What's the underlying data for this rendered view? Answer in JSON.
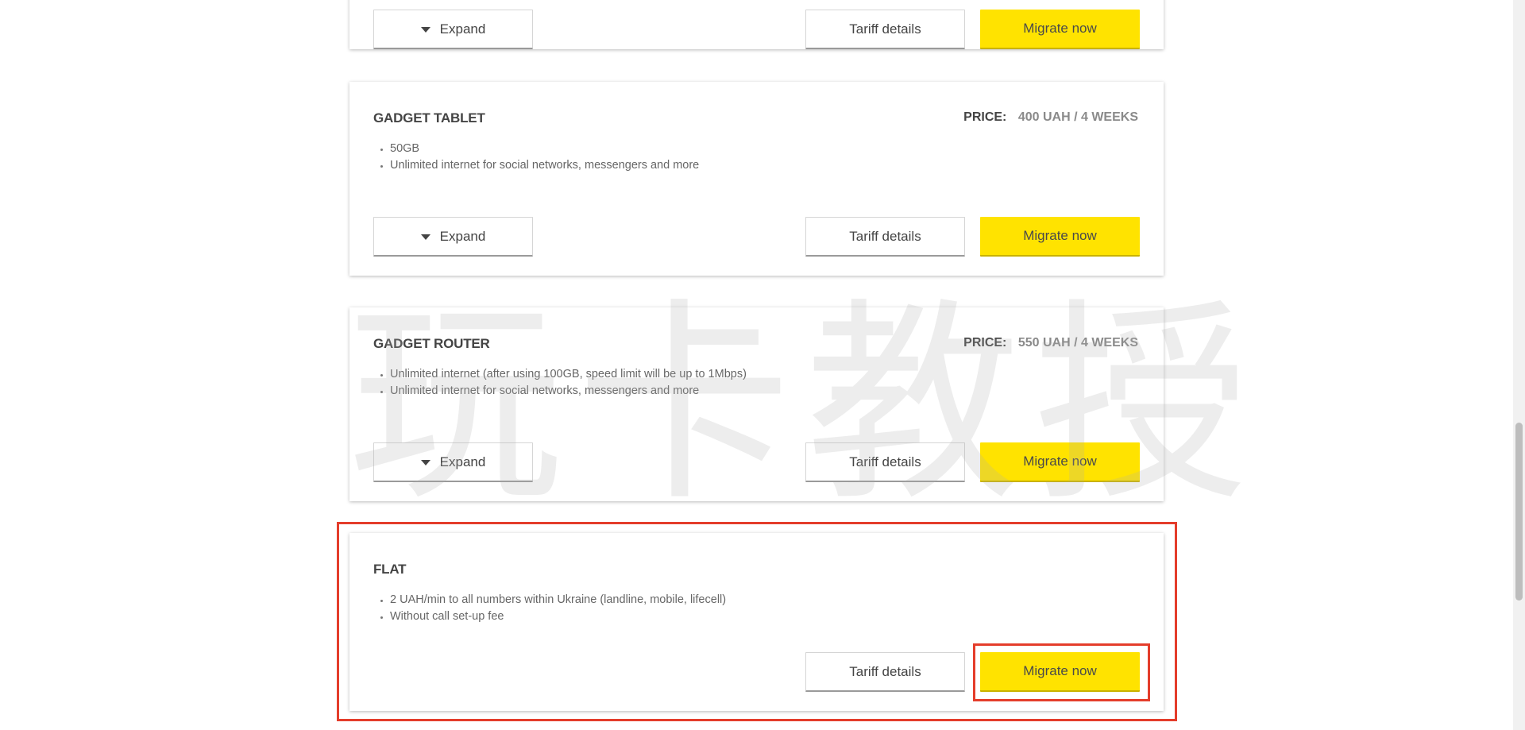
{
  "buttons": {
    "expand_label": "Expand",
    "details_label": "Tariff details",
    "migrate_label": "Migrate now"
  },
  "price_label": "PRICE:",
  "tariffs": [
    {
      "title": "",
      "price": "",
      "features": []
    },
    {
      "title": "GADGET TABLET",
      "price": "400 UAH / 4 WEEKS",
      "features": [
        "50GB",
        "Unlimited internet for social networks, messengers and more"
      ]
    },
    {
      "title": "GADGET ROUTER",
      "price": "550 UAH / 4 WEEKS",
      "features": [
        "Unlimited internet (after using 100GB, speed limit will be up to 1Mbps)",
        "Unlimited internet for social networks, messengers and more"
      ]
    },
    {
      "title": "FLAT",
      "price": "",
      "features": [
        "2 UAH/min to all numbers within Ukraine (landline, mobile, lifecell)",
        "Without call set-up fee"
      ]
    }
  ],
  "watermark": "玩卡教授",
  "colors": {
    "accent_yellow": "#ffe300",
    "highlight_red": "#e43d2b"
  }
}
